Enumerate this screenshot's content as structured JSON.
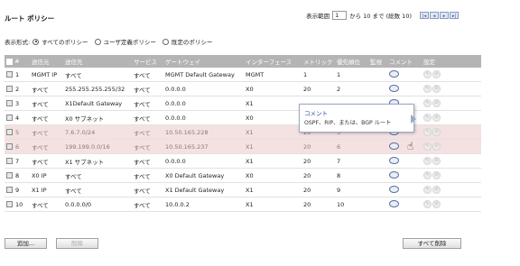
{
  "page_title": "ルート ポリシー",
  "pager": {
    "prefix": "表示範囲",
    "value": "1",
    "suffix": "から 10 まで (総数 10)"
  },
  "view": {
    "label": "表示形式:",
    "options": [
      {
        "label": "すべてのポリシー",
        "selected": true
      },
      {
        "label": "ユーザ定義ポリシー",
        "selected": false
      },
      {
        "label": "既定のポリシー",
        "selected": false
      }
    ]
  },
  "table": {
    "headers": [
      "#",
      "送信元",
      "送信先",
      "サービス",
      "ゲートウェイ",
      "インターフェース",
      "メトリック",
      "優先順位",
      "監視",
      "コメント",
      "設定"
    ],
    "rows": [
      {
        "n": "1",
        "src": "MGMT IP",
        "dst": "すべて",
        "svc": "すべて",
        "gw": "MGMT Default Gateway",
        "if": "MGMT",
        "metric": "1",
        "prio": "1",
        "style": "normal"
      },
      {
        "n": "2",
        "src": "すべて",
        "dst": "255.255.255.255/32",
        "svc": "すべて",
        "gw": "0.0.0.0",
        "if": "X0",
        "metric": "20",
        "prio": "2",
        "style": "normal"
      },
      {
        "n": "3",
        "src": "すべて",
        "dst": "X1Default Gateway",
        "svc": "すべて",
        "gw": "0.0.0.0",
        "if": "X1",
        "metric": "",
        "prio": "",
        "style": "normal"
      },
      {
        "n": "4",
        "src": "すべて",
        "dst": "X0 サブネット",
        "svc": "すべて",
        "gw": "0.0.0.0",
        "if": "X0",
        "metric": "",
        "prio": "",
        "style": "normal"
      },
      {
        "n": "5",
        "src": "すべて",
        "dst": "7.6.7.0/24",
        "svc": "すべて",
        "gw": "10.50.165.228",
        "if": "X1",
        "metric": "20",
        "prio": "5",
        "style": "red"
      },
      {
        "n": "6",
        "src": "すべて",
        "dst": "199.199.0.0/16",
        "svc": "すべて",
        "gw": "10.50.165.237",
        "if": "X1",
        "metric": "20",
        "prio": "6",
        "style": "red"
      },
      {
        "n": "7",
        "src": "すべて",
        "dst": "X1 サブネット",
        "svc": "すべて",
        "gw": "0.0.0.0",
        "if": "X1",
        "metric": "20",
        "prio": "7",
        "style": "normal"
      },
      {
        "n": "8",
        "src": "X0 IP",
        "dst": "すべて",
        "svc": "すべて",
        "gw": "X0 Default Gateway",
        "if": "X0",
        "metric": "20",
        "prio": "8",
        "style": "normal"
      },
      {
        "n": "9",
        "src": "X1 IP",
        "dst": "すべて",
        "svc": "すべて",
        "gw": "X1 Default Gateway",
        "if": "X1",
        "metric": "20",
        "prio": "9",
        "style": "normal"
      },
      {
        "n": "10",
        "src": "すべて",
        "dst": "0.0.0.0/0",
        "svc": "すべて",
        "gw": "10.0.0.2",
        "if": "X1",
        "metric": "20",
        "prio": "10",
        "style": "normal"
      }
    ]
  },
  "tooltip": {
    "title": "コメント",
    "body": "OSPF、RIP、または、BGP ルート"
  },
  "buttons": {
    "add": "追加...",
    "delete": "削除",
    "delete_all": "すべて削除"
  }
}
